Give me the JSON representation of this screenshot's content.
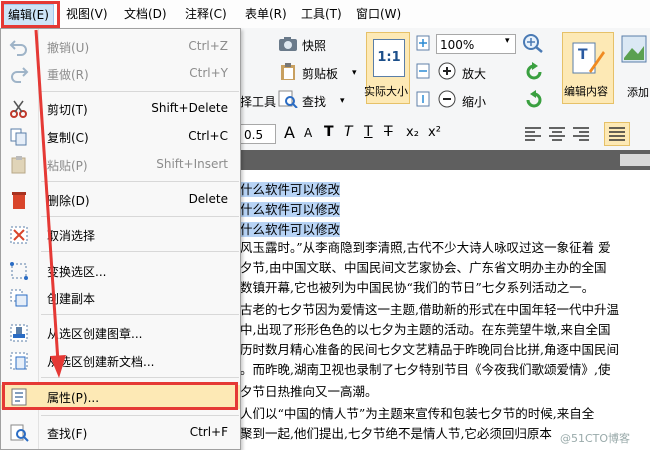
{
  "menubar": {
    "items": [
      {
        "label": "编辑(E)",
        "active": true
      },
      {
        "label": "视图(V)"
      },
      {
        "label": "文档(D)"
      },
      {
        "label": "注释(C)"
      },
      {
        "label": "表单(R)"
      },
      {
        "label": "工具(T)"
      },
      {
        "label": "窗口(W)"
      }
    ]
  },
  "ribbon": {
    "snapshot_label": "快照",
    "clipboard_label": "剪贴板",
    "select_tool_partial": "择工具",
    "find_label": "查找",
    "actual_size_label": "实际大小",
    "actual_size_icon_text": "1:1",
    "zoom_value": "100%",
    "zoom_in_label": "放大",
    "zoom_out_label": "缩小",
    "edit_content_label": "编辑内容",
    "add_partial": "添加",
    "font_size_partial": "0.5",
    "format_glyphs": [
      "A",
      "A",
      "T",
      "T",
      "T",
      "T",
      "x₂",
      "x²"
    ]
  },
  "edit_menu": {
    "items": [
      {
        "label": "撤销(U)",
        "shortcut": "Ctrl+Z",
        "disabled": true,
        "icon": "undo-icon"
      },
      {
        "label": "重做(R)",
        "shortcut": "Ctrl+Y",
        "disabled": true,
        "icon": "redo-icon"
      },
      {
        "label": "剪切(T)",
        "shortcut": "Shift+Delete",
        "disabled": false,
        "icon": "scissors-icon"
      },
      {
        "label": "复制(C)",
        "shortcut": "Ctrl+C",
        "disabled": false,
        "icon": "copy-icon"
      },
      {
        "label": "粘贴(P)",
        "shortcut": "Shift+Insert",
        "disabled": true,
        "icon": "paste-icon"
      },
      {
        "label": "删除(D)",
        "shortcut": "Delete",
        "disabled": false,
        "icon": "trash-icon"
      },
      {
        "label": "取消选择",
        "shortcut": "",
        "disabled": false,
        "icon": "deselect-icon"
      },
      {
        "label": "变换选区...",
        "shortcut": "",
        "disabled": false,
        "icon": "transform-selection-icon"
      },
      {
        "label": "创建副本",
        "shortcut": "",
        "disabled": false,
        "icon": "duplicate-icon"
      },
      {
        "label": "从选区创建图章...",
        "shortcut": "",
        "disabled": false,
        "icon": "stamp-icon"
      },
      {
        "label": "从选区创建新文档...",
        "shortcut": "",
        "disabled": false,
        "icon": "new-document-icon"
      },
      {
        "label": "属性(P)...",
        "shortcut": "",
        "disabled": false,
        "icon": "properties-icon",
        "highlighted": true
      },
      {
        "label": "查找(F)",
        "shortcut": "Ctrl+F",
        "disabled": false,
        "icon": "find-icon"
      }
    ]
  },
  "document": {
    "lines": [
      "什么软件可以修改",
      "什么软件可以修改",
      "什么软件可以修改",
      "风玉露时。”从李商隐到李清照,古代不少大诗人咏叹过这一象征着 爱",
      "夕节,由中国文联、中国民间文艺家协会、广东省文明办主办的全国",
      "数镇开幕,它也被列为中国民协“我们的节日”七夕系列活动之一。",
      "古老的七夕节因为爱情这一主题,借助新的形式在中国年轻一代中升温",
      "中,出现了形形色色的以七夕为主题的活动。在东莞望牛墩,来自全国",
      "历时数月精心准备的民间七夕文艺精品于昨晚同台比拼,角逐中国民间",
      "。而昨晚,湖南卫视也录制了七夕特别节目《今夜我们歌颂爱情》,使",
      "夕节日热推向又一高潮。",
      "人们以“中国的情人节”为主题来宣传和包装七夕节的时候,来自全",
      "聚到一起,他们提出,七夕节绝不是情人节,它必须回归原本"
    ]
  },
  "colors": {
    "highlight_red": "#e53935",
    "selection_blue": "#b7d3f5",
    "menu_active": "#cde4f7"
  },
  "watermark": "@51CTO博客"
}
